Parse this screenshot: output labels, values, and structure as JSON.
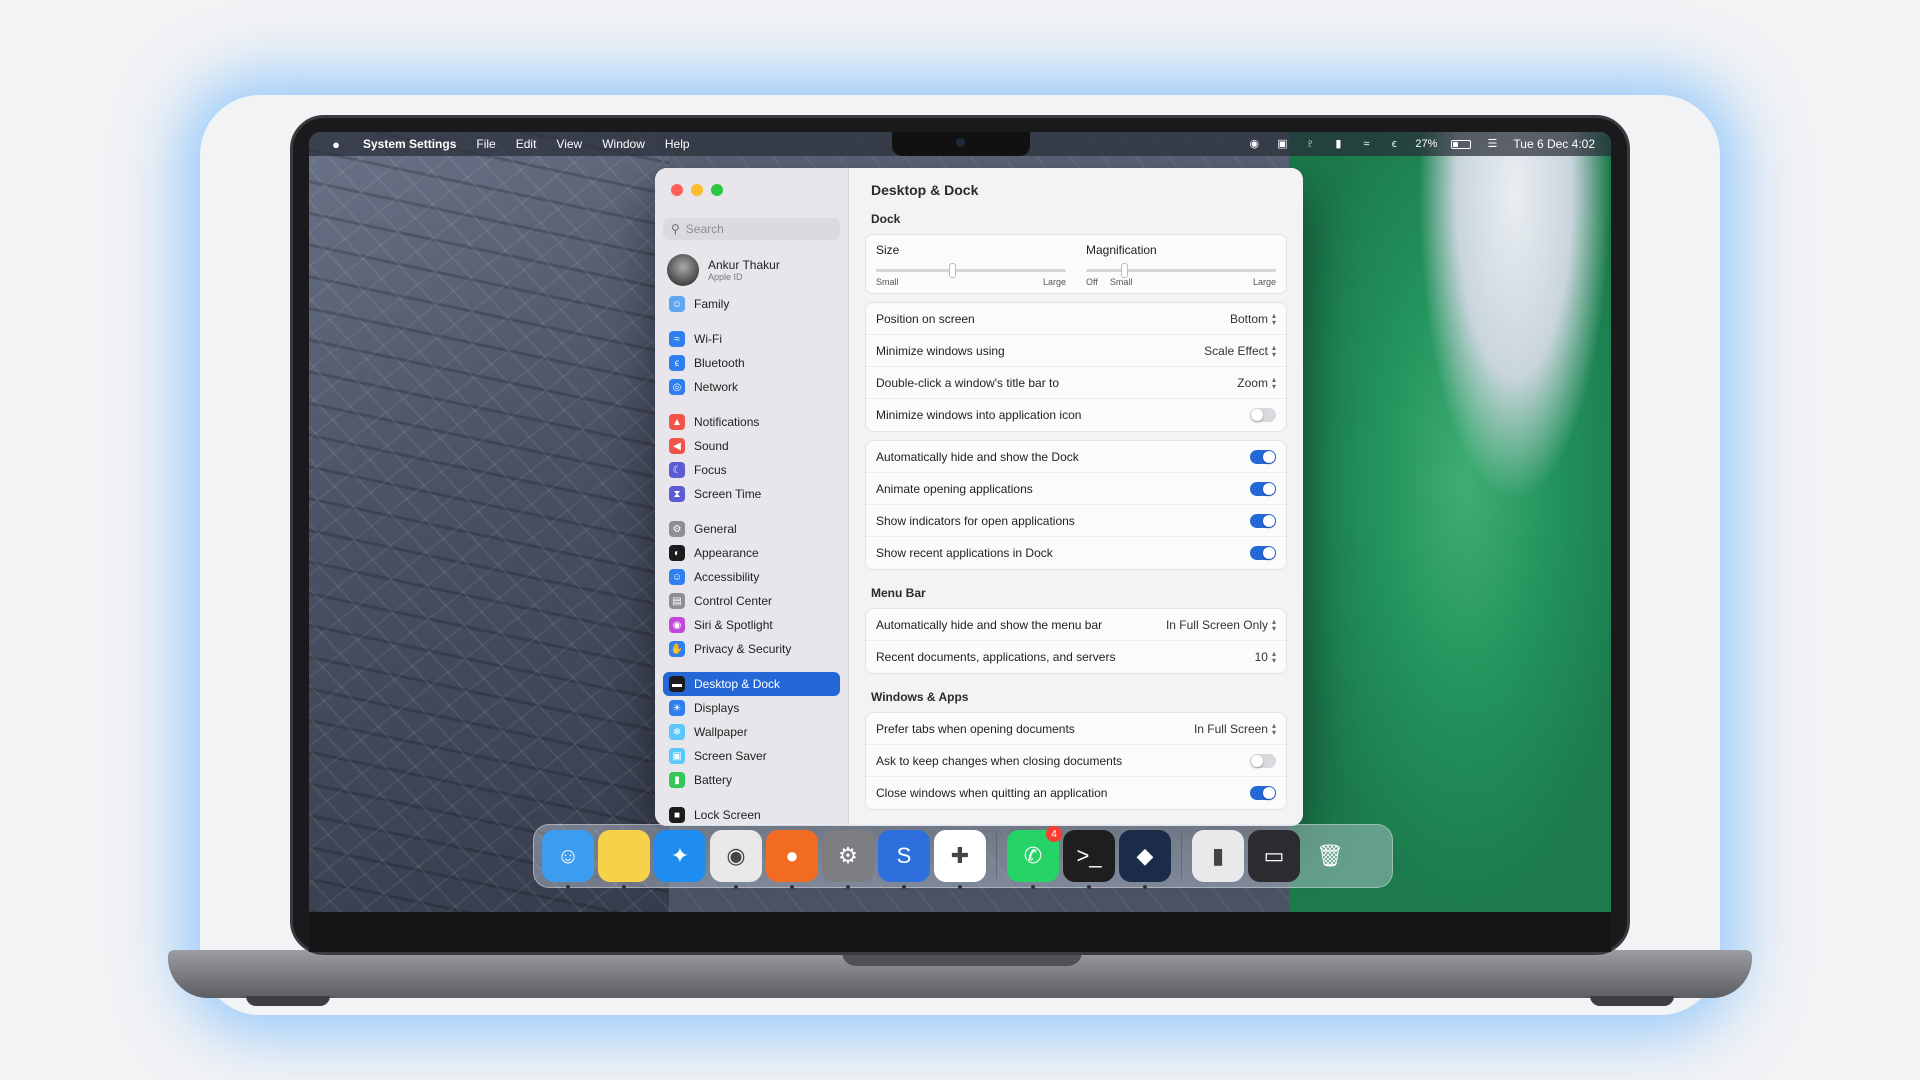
{
  "menubar": {
    "app_name": "System Settings",
    "menus": [
      "File",
      "Edit",
      "View",
      "Window",
      "Help"
    ],
    "battery_percent": "27%",
    "battery_level": 0.27,
    "datetime": "Tue 6 Dec  4:02"
  },
  "window": {
    "search_placeholder": "Search",
    "profile": {
      "name": "Ankur Thakur",
      "subtitle": "Apple ID"
    },
    "sidebar_items": [
      {
        "label": "Family",
        "icon": "family-icon",
        "color": "#5fa6f0"
      },
      {
        "label": "Wi-Fi",
        "icon": "wifi-icon",
        "color": "#2f7ff0"
      },
      {
        "label": "Bluetooth",
        "icon": "bluetooth-icon",
        "color": "#2f7ff0"
      },
      {
        "label": "Network",
        "icon": "globe-icon",
        "color": "#2f7ff0"
      },
      {
        "label": "Notifications",
        "icon": "bell-icon",
        "color": "#f2544a"
      },
      {
        "label": "Sound",
        "icon": "speaker-icon",
        "color": "#f2544a"
      },
      {
        "label": "Focus",
        "icon": "moon-icon",
        "color": "#5b5bd6"
      },
      {
        "label": "Screen Time",
        "icon": "hourglass-icon",
        "color": "#5b5bd6"
      },
      {
        "label": "General",
        "icon": "gear-icon",
        "color": "#8e8e93"
      },
      {
        "label": "Appearance",
        "icon": "appearance-icon",
        "color": "#1c1c1e"
      },
      {
        "label": "Accessibility",
        "icon": "accessibility-icon",
        "color": "#2f7ff0"
      },
      {
        "label": "Control Center",
        "icon": "control-center-icon",
        "color": "#8e8e93"
      },
      {
        "label": "Siri & Spotlight",
        "icon": "siri-icon",
        "color": "#c04ad8"
      },
      {
        "label": "Privacy & Security",
        "icon": "hand-icon",
        "color": "#2f7ff0"
      },
      {
        "label": "Desktop & Dock",
        "icon": "dock-icon",
        "color": "#1c1c1e"
      },
      {
        "label": "Displays",
        "icon": "sun-icon",
        "color": "#2f7ff0"
      },
      {
        "label": "Wallpaper",
        "icon": "wallpaper-icon",
        "color": "#5ac8fa"
      },
      {
        "label": "Screen Saver",
        "icon": "screensaver-icon",
        "color": "#5ac8fa"
      },
      {
        "label": "Battery",
        "icon": "battery-icon",
        "color": "#34c759"
      },
      {
        "label": "Lock Screen",
        "icon": "lock-icon",
        "color": "#1c1c1e"
      }
    ],
    "active_item": "Desktop & Dock",
    "content": {
      "title": "Desktop & Dock",
      "dock_section": "Dock",
      "size_label": "Size",
      "size_min": "Small",
      "size_max": "Large",
      "size_value": 0.4,
      "magnification_label": "Magnification",
      "mag_off": "Off",
      "mag_min": "Small",
      "mag_max": "Large",
      "mag_value": 0.2,
      "dock_select_rows": [
        {
          "label": "Position on screen",
          "value": "Bottom"
        },
        {
          "label": "Minimize windows using",
          "value": "Scale Effect"
        },
        {
          "label": "Double-click a window's title bar to",
          "value": "Zoom"
        }
      ],
      "minimize_into_icon": {
        "label": "Minimize windows into application icon",
        "on": false
      },
      "dock_toggles": [
        {
          "label": "Automatically hide and show the Dock",
          "on": true
        },
        {
          "label": "Animate opening applications",
          "on": true
        },
        {
          "label": "Show indicators for open applications",
          "on": true
        },
        {
          "label": "Show recent applications in Dock",
          "on": true
        }
      ],
      "menubar_section": "Menu Bar",
      "menubar_rows": [
        {
          "label": "Automatically hide and show the menu bar",
          "value": "In Full Screen Only"
        },
        {
          "label": "Recent documents, applications, and servers",
          "value": "10"
        }
      ],
      "windows_section": "Windows & Apps",
      "windows_select": {
        "label": "Prefer tabs when opening documents",
        "value": "In Full Screen"
      },
      "windows_toggles": [
        {
          "label": "Ask to keep changes when closing documents",
          "on": false
        },
        {
          "label": "Close windows when quitting an application",
          "on": true
        }
      ]
    }
  },
  "dock": {
    "apps": [
      {
        "name": "finder-icon",
        "glyph": "☺",
        "bg": "#3c9cf0",
        "running": true
      },
      {
        "name": "notes-icon",
        "glyph": "",
        "bg": "#f7d14a",
        "running": true
      },
      {
        "name": "safari-icon",
        "glyph": "✦",
        "bg": "#1f8cf0",
        "running": false
      },
      {
        "name": "chrome-icon",
        "glyph": "◉",
        "bg": "#e8e8e8",
        "running": true
      },
      {
        "name": "firefox-icon",
        "glyph": "●",
        "bg": "#f26b22",
        "running": true
      },
      {
        "name": "system-settings-icon",
        "glyph": "⚙",
        "bg": "#7d7d82",
        "running": true
      },
      {
        "name": "simplenote-icon",
        "glyph": "S",
        "bg": "#2d6fdc",
        "running": true
      },
      {
        "name": "slack-icon",
        "glyph": "✚",
        "bg": "#ffffff",
        "running": true
      },
      {
        "name": "whatsapp-icon",
        "glyph": "✆",
        "bg": "#25d366",
        "running": true,
        "badge": "4"
      },
      {
        "name": "terminal-icon",
        "glyph": ">_",
        "bg": "#1e1e1e",
        "running": true
      },
      {
        "name": "teamviewer-icon",
        "glyph": "◆",
        "bg": "#1b2b4a",
        "running": true
      }
    ],
    "others": [
      {
        "name": "zip-file-icon",
        "glyph": "▮",
        "bg": "#e9e9ec"
      },
      {
        "name": "screenshot-stack-icon",
        "glyph": "▭",
        "bg": "#2b2b30"
      },
      {
        "name": "trash-icon",
        "glyph": "🗑",
        "bg": "transparent"
      }
    ]
  }
}
